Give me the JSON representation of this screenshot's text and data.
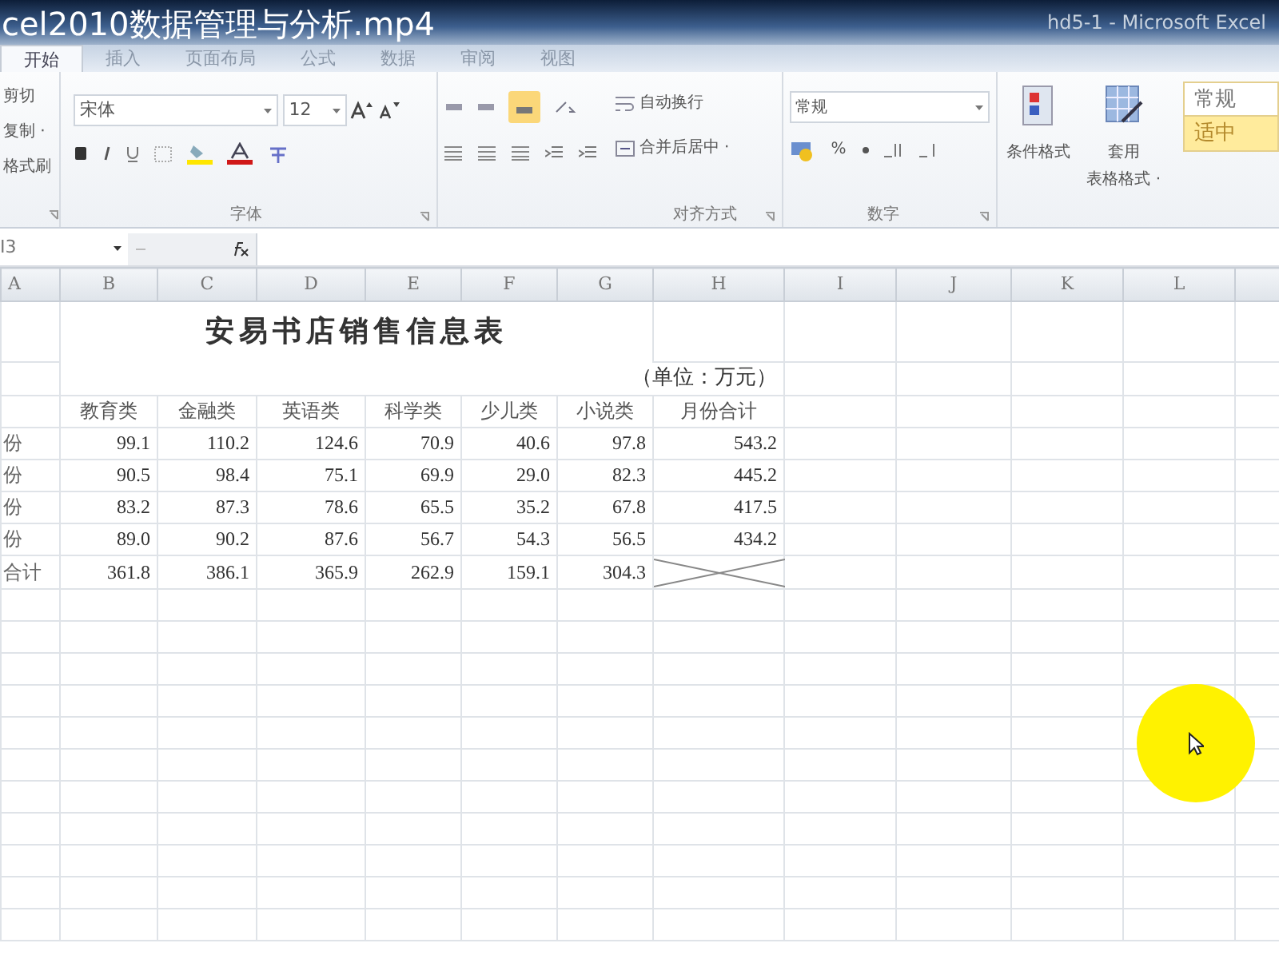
{
  "video_title": "cel2010数据管理与分析.mp4",
  "window": {
    "title": "hd5-1 - Microsoft Excel"
  },
  "tabs": [
    {
      "label": "开始",
      "selected": true
    },
    {
      "label": "插入",
      "selected": false
    },
    {
      "label": "页面布局",
      "selected": false
    },
    {
      "label": "公式",
      "selected": false
    },
    {
      "label": "数据",
      "selected": false
    },
    {
      "label": "审阅",
      "selected": false
    },
    {
      "label": "视图",
      "selected": false
    }
  ],
  "ribbon": {
    "clipboard": [
      "剪切",
      "复制 ·",
      "格式刷"
    ],
    "font": {
      "name": "宋体",
      "size": "12",
      "label": "字体"
    },
    "alignment": {
      "wrap": "自动换行",
      "merge": "合并后居中 ·",
      "label": "对齐方式"
    },
    "number": {
      "format": "常规",
      "percent": "%",
      "label": "数字"
    },
    "styles": {
      "conditional": "条件格式",
      "table_format": [
        "套用",
        "表格格式 ·"
      ],
      "cells": [
        {
          "label": "常规",
          "color": "#ffffff"
        },
        {
          "label": "适中",
          "color": "#ffeb9c"
        }
      ]
    }
  },
  "formula_bar": {
    "name_box": "I3"
  },
  "sheet": {
    "columns": [
      "A",
      "B",
      "C",
      "D",
      "E",
      "F",
      "G",
      "H",
      "I",
      "J",
      "K",
      "L"
    ],
    "title": "安易书店销售信息表",
    "unit": "（单位：万元）",
    "headers": [
      "教育类",
      "金融类",
      "英语类",
      "科学类",
      "少儿类",
      "小说类",
      "月份合计"
    ],
    "rows": [
      {
        "label": "份",
        "values": [
          "99.1",
          "110.2",
          "124.6",
          "70.9",
          "40.6",
          "97.8",
          "543.2"
        ]
      },
      {
        "label": "份",
        "values": [
          "90.5",
          "98.4",
          "75.1",
          "69.9",
          "29.0",
          "82.3",
          "445.2"
        ]
      },
      {
        "label": "份",
        "values": [
          "83.2",
          "87.3",
          "78.6",
          "65.5",
          "35.2",
          "67.8",
          "417.5"
        ]
      },
      {
        "label": "份",
        "values": [
          "89.0",
          "90.2",
          "87.6",
          "56.7",
          "54.3",
          "56.5",
          "434.2"
        ]
      },
      {
        "label": "合计",
        "values": [
          "361.8",
          "386.1",
          "365.9",
          "262.9",
          "159.1",
          "304.3"
        ],
        "diagonal": true
      }
    ]
  }
}
